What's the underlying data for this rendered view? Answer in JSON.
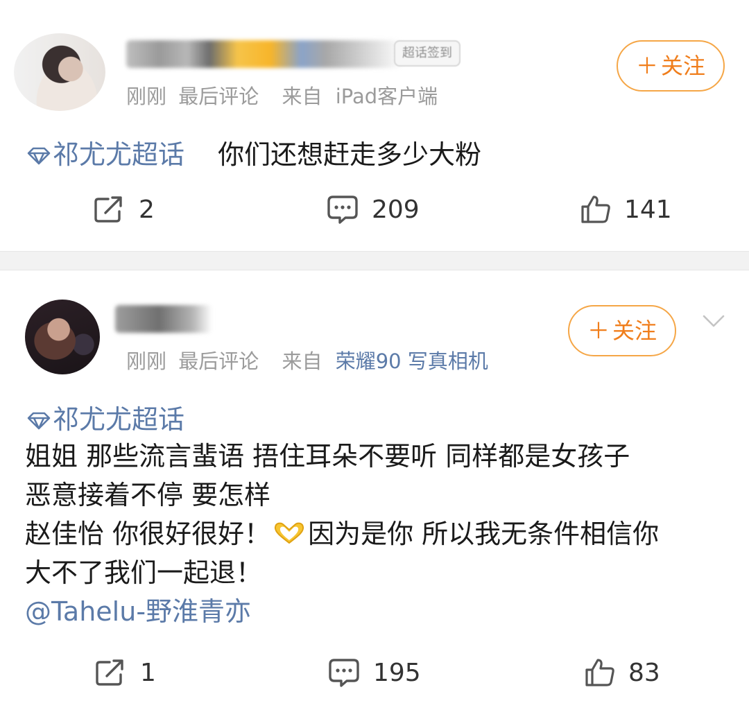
{
  "post1": {
    "meta": {
      "time": "刚刚",
      "activity": "最后评论",
      "from_label": "来自",
      "device": "iPad客户端"
    },
    "follow_label": "关注",
    "topic": "祁尤尤超话",
    "text": "你们还想赶走多少大粉",
    "stats": {
      "reposts": "2",
      "comments": "209",
      "likes": "141"
    }
  },
  "post2": {
    "meta": {
      "time": "刚刚",
      "activity": "最后评论",
      "from_label": "来自",
      "device": "荣耀90 写真相机"
    },
    "follow_label": "关注",
    "topic": "祁尤尤超话",
    "lines": [
      "姐姐 那些流言蜚语 捂住耳朵不要听 同样都是女孩子",
      "恶意接着不停 要怎样",
      "赵佳怡 你很好很好！",
      "因为是你 所以我无条件相信你",
      "大不了我们一起退！"
    ],
    "mention": "@Tahelu-野淮青亦",
    "stats": {
      "reposts": "1",
      "comments": "195",
      "likes": "83"
    }
  },
  "colors": {
    "link": "#5b7aa8",
    "accent": "#f07e1c",
    "follow_border": "#f5a646"
  },
  "icons": [
    "repost-icon",
    "comment-icon",
    "like-icon",
    "diamond-icon",
    "heart-hands-icon",
    "chevron-down-icon"
  ]
}
